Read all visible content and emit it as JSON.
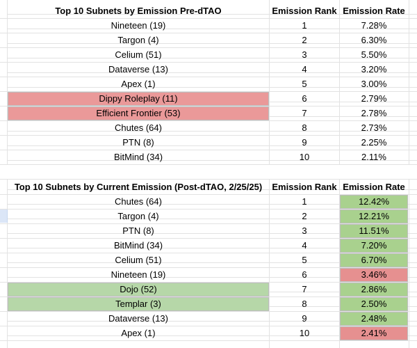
{
  "table1": {
    "header": {
      "subnet": "Top 10 Subnets by Emission Pre-dTAO",
      "rank": "Emission Rank",
      "rate": "Emission Rate"
    },
    "rows": [
      {
        "subnet": "Nineteen (19)",
        "rank": "1",
        "rate": "7.28%",
        "highlight": ""
      },
      {
        "subnet": "Targon (4)",
        "rank": "2",
        "rate": "6.30%",
        "highlight": ""
      },
      {
        "subnet": "Celium (51)",
        "rank": "3",
        "rate": "5.50%",
        "highlight": ""
      },
      {
        "subnet": "Dataverse (13)",
        "rank": "4",
        "rate": "3.20%",
        "highlight": ""
      },
      {
        "subnet": "Apex (1)",
        "rank": "5",
        "rate": "3.00%",
        "highlight": ""
      },
      {
        "subnet": "Dippy Roleplay (11)",
        "rank": "6",
        "rate": "2.79%",
        "highlight": "red"
      },
      {
        "subnet": "Efficient Frontier (53)",
        "rank": "7",
        "rate": "2.78%",
        "highlight": "red"
      },
      {
        "subnet": "Chutes (64)",
        "rank": "8",
        "rate": "2.73%",
        "highlight": ""
      },
      {
        "subnet": "PTN (8)",
        "rank": "9",
        "rate": "2.25%",
        "highlight": ""
      },
      {
        "subnet": "BitMind (34)",
        "rank": "10",
        "rate": "2.11%",
        "highlight": ""
      }
    ]
  },
  "table2": {
    "header": {
      "subnet": "Top 10 Subnets by Current Emission (Post-dTAO, 2/25/25)",
      "rank": "Emission Rank",
      "rate": "Emission Rate"
    },
    "rows": [
      {
        "subnet": "Chutes (64)",
        "rank": "1",
        "rate": "12.42%",
        "highlight": "",
        "rate_color": "green"
      },
      {
        "subnet": "Targon (4)",
        "rank": "2",
        "rate": "12.21%",
        "highlight": "",
        "rate_color": "green"
      },
      {
        "subnet": "PTN (8)",
        "rank": "3",
        "rate": "11.51%",
        "highlight": "",
        "rate_color": "green"
      },
      {
        "subnet": "BitMind (34)",
        "rank": "4",
        "rate": "7.20%",
        "highlight": "",
        "rate_color": "green"
      },
      {
        "subnet": "Celium (51)",
        "rank": "5",
        "rate": "6.70%",
        "highlight": "",
        "rate_color": "green"
      },
      {
        "subnet": "Nineteen (19)",
        "rank": "6",
        "rate": "3.46%",
        "highlight": "",
        "rate_color": "red"
      },
      {
        "subnet": "Dojo (52)",
        "rank": "7",
        "rate": "2.86%",
        "highlight": "green",
        "rate_color": "green"
      },
      {
        "subnet": "Templar (3)",
        "rank": "8",
        "rate": "2.50%",
        "highlight": "green",
        "rate_color": "green"
      },
      {
        "subnet": "Dataverse (13)",
        "rank": "9",
        "rate": "2.48%",
        "highlight": "",
        "rate_color": "green"
      },
      {
        "subnet": "Apex (1)",
        "rank": "10",
        "rate": "2.41%",
        "highlight": "",
        "rate_color": "red"
      }
    ]
  },
  "colors": {
    "highlight_red": "#ea9999",
    "highlight_green": "#b6d7a8",
    "rate_red": "#e69090",
    "rate_green": "#a9d18e",
    "gridline": "#e2e2e2"
  }
}
